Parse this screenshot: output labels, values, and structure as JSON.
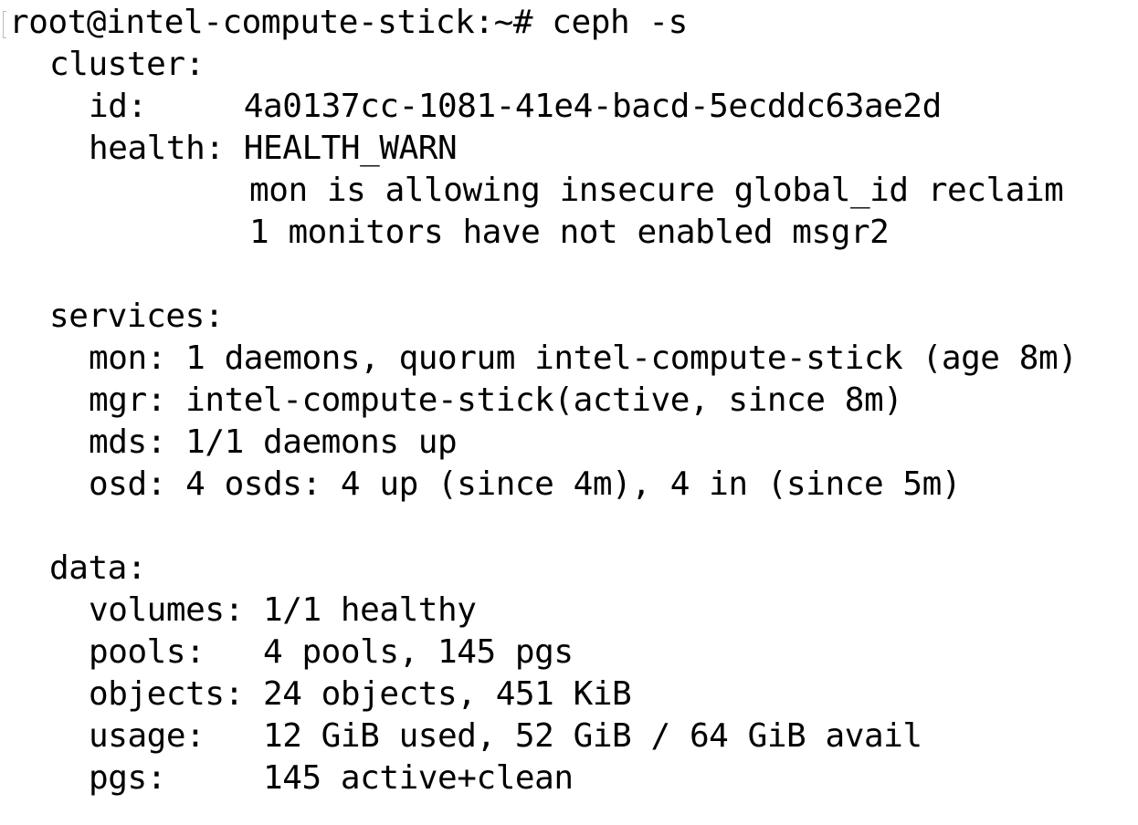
{
  "prompt": "root@intel-compute-stick:~# ceph -s",
  "cluster": {
    "label": "cluster:",
    "id_line": "id:     4a0137cc-1081-41e4-bacd-5ecddc63ae2d",
    "health_line": "health: HEALTH_WARN",
    "health_detail_1": "mon is allowing insecure global_id reclaim",
    "health_detail_2": "1 monitors have not enabled msgr2"
  },
  "services": {
    "label": "services:",
    "mon": "mon: 1 daemons, quorum intel-compute-stick (age 8m)",
    "mgr": "mgr: intel-compute-stick(active, since 8m)",
    "mds": "mds: 1/1 daemons up",
    "osd": "osd: 4 osds: 4 up (since 4m), 4 in (since 5m)"
  },
  "data": {
    "label": "data:",
    "volumes": "volumes: 1/1 healthy",
    "pools": "pools:   4 pools, 145 pgs",
    "objects": "objects: 24 objects, 451 KiB",
    "usage": "usage:   12 GiB used, 52 GiB / 64 GiB avail",
    "pgs": "pgs:     145 active+clean"
  }
}
